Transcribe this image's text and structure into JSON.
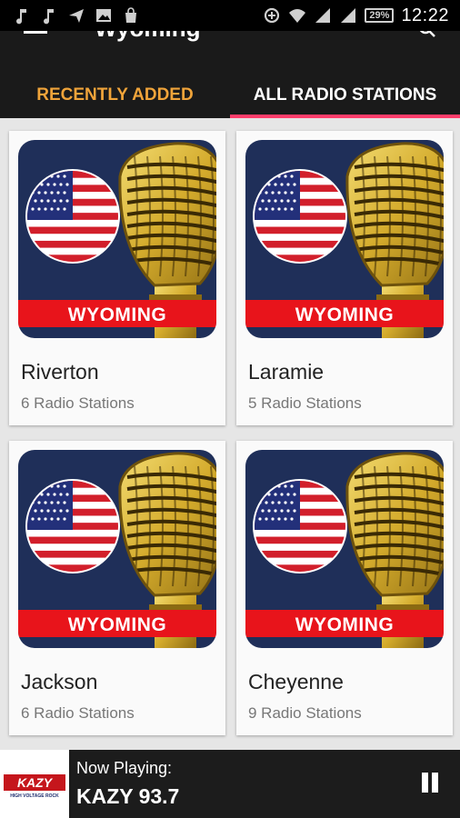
{
  "status_bar": {
    "time": "12:22",
    "battery": "29%"
  },
  "toolbar": {
    "title": "Wyoming"
  },
  "tabs": [
    {
      "label": "RECENTLY ADDED"
    },
    {
      "label": "ALL RADIO STATIONS"
    }
  ],
  "cities": [
    {
      "name": "Riverton",
      "count": "6 Radio Stations",
      "banner": "WYOMING"
    },
    {
      "name": "Laramie",
      "count": "5 Radio Stations",
      "banner": "WYOMING"
    },
    {
      "name": "Jackson",
      "count": "6 Radio Stations",
      "banner": "WYOMING"
    },
    {
      "name": "Cheyenne",
      "count": "9 Radio Stations",
      "banner": "WYOMING"
    }
  ],
  "player": {
    "label": "Now Playing:",
    "station": "KAZY 93.7",
    "logo_text": "KAZY",
    "logo_sub": "HIGH VOLTAGE ROCK"
  },
  "colors": {
    "accent_tab": "#f0a43a",
    "indicator": "#ff3d6b",
    "banner_red": "#e8141b",
    "thumb_bg": "#1f2f59"
  }
}
